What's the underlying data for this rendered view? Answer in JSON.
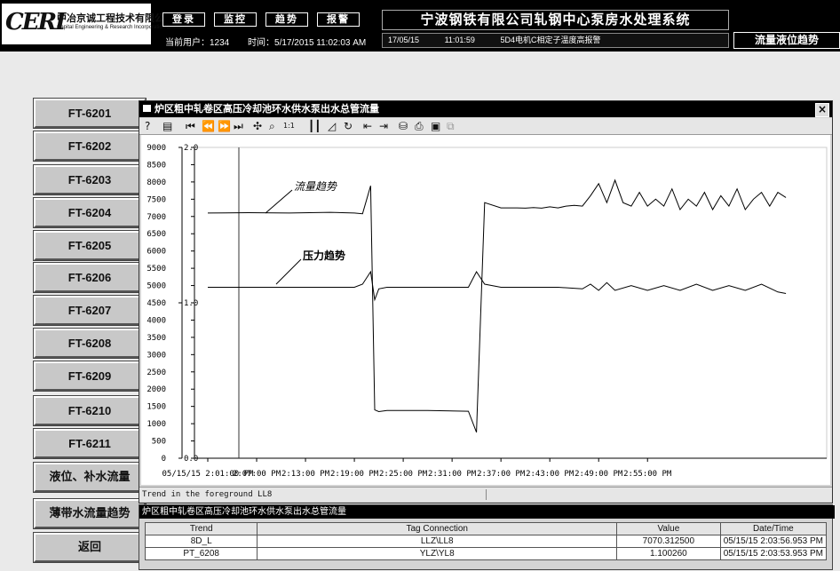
{
  "logo": {
    "mark": "CERI",
    "cn": "中冶京诚工程技术有限公司",
    "en": "Capital Engineering & Research Incorporation Limited"
  },
  "nav": [
    "登录",
    "监控",
    "趋势",
    "报警"
  ],
  "user_line": {
    "user": "当前用户：1234",
    "time": "时间：5/17/2015 11:02:03 AM"
  },
  "system_title": "宁波钢铁有限公司轧钢中心泵房水处理系统",
  "alarm": {
    "date": "17/05/15",
    "time": "11:01:59",
    "text": "5D4电机C相定子温度高报警"
  },
  "trend_title": "流量液位趋势",
  "sidebar": [
    "FT-6201",
    "FT-6202",
    "FT-6203",
    "FT-6204",
    "FT-6205",
    "FT-6206",
    "FT-6207",
    "FT-6208",
    "FT-6209",
    "FT-6210",
    "FT-6211",
    "液位、补水流量",
    "薄带水流量趋势",
    "返回"
  ],
  "window": {
    "title": "炉区粗中轧卷区高压冷却池环水供水泵出水总管流量",
    "close": "×",
    "toolbar_icons": [
      "help-icon",
      "legend-icon",
      "first-icon",
      "prev-icon",
      "next-icon",
      "last-icon",
      "cursor-icon",
      "zoom-icon",
      "original-size-icon",
      "bar-icon",
      "line-icon",
      "refresh-icon",
      "start-icon",
      "end-icon",
      "save-icon",
      "print-icon",
      "export-icon",
      "copy-icon"
    ],
    "status": "Trend in the foreground LL8"
  },
  "chart_data": {
    "type": "line",
    "y_left": {
      "ticks": [
        0,
        500,
        1000,
        1500,
        2000,
        2500,
        3000,
        3500,
        4000,
        4500,
        5000,
        5500,
        6000,
        6500,
        7000,
        7500,
        8000,
        8500,
        9000
      ],
      "range": [
        0,
        9000
      ]
    },
    "y_right": {
      "ticks": [
        "0.0",
        "1.0",
        "2.0"
      ],
      "range": [
        0,
        2
      ]
    },
    "x_ticks": [
      "05/15/15  2:01:00 PM",
      "2:07:00 PM",
      "2:13:00 PM",
      "2:19:00 PM",
      "2:25:00 PM",
      "2:31:00 PM",
      "2:37:00 PM",
      "2:43:00 PM",
      "2:49:00 PM",
      "2:55:00 PM"
    ],
    "annotations": [
      "流量趋势",
      "压力趋势"
    ],
    "series": [
      {
        "name": "8D_L",
        "color": "#000000",
        "x_min": [
          0,
          5,
          10,
          15,
          18,
          19,
          20,
          20.5,
          21,
          22,
          27,
          32,
          33,
          34,
          36,
          38,
          39,
          40,
          41,
          42,
          43,
          44,
          45,
          46,
          47,
          48,
          49,
          50,
          51,
          52,
          53,
          54,
          55,
          56,
          57,
          58,
          59,
          60,
          61,
          62,
          63,
          64,
          65,
          66,
          67,
          68,
          69,
          70,
          71
        ],
        "values": [
          7100,
          7110,
          7100,
          7120,
          7100,
          7080,
          7890,
          1400,
          1350,
          1380,
          1380,
          1360,
          750,
          7400,
          7250,
          7250,
          7240,
          7260,
          7240,
          7280,
          7250,
          7300,
          7320,
          7300,
          7600,
          7950,
          7400,
          8050,
          7400,
          7300,
          7700,
          7300,
          7500,
          7300,
          7800,
          7200,
          7500,
          7300,
          7700,
          7200,
          7600,
          7300,
          7800,
          7200,
          7500,
          7700,
          7300,
          7700,
          7550
        ]
      },
      {
        "name": "PT_6208",
        "color": "#000000",
        "x_min": [
          0,
          5,
          10,
          15,
          18,
          19,
          20,
          20.5,
          21,
          22,
          27,
          32,
          33,
          34,
          36,
          38,
          40,
          43,
          46,
          47,
          48,
          49,
          50,
          52,
          54,
          56,
          58,
          60,
          62,
          64,
          66,
          68,
          70,
          71
        ],
        "values": [
          1.1,
          1.1,
          1.1,
          1.1,
          1.1,
          1.12,
          1.2,
          1.02,
          1.09,
          1.1,
          1.1,
          1.1,
          1.2,
          1.12,
          1.1,
          1.1,
          1.1,
          1.1,
          1.09,
          1.12,
          1.08,
          1.13,
          1.08,
          1.11,
          1.08,
          1.11,
          1.08,
          1.12,
          1.08,
          1.11,
          1.08,
          1.12,
          1.07,
          1.06
        ]
      }
    ]
  },
  "tag_panel": {
    "title": "炉区粗中轧卷区高压冷却池环水供水泵出水总管流量",
    "columns": [
      "Trend",
      "Tag Connection",
      "Value",
      "Date/Time"
    ],
    "rows": [
      [
        "8D_L",
        "LLZ\\LL8",
        "7070.312500",
        "05/15/15 2:03:56.953 PM"
      ],
      [
        "PT_6208",
        "YLZ\\YL8",
        "1.100260",
        "05/15/15 2:03:53.953 PM"
      ]
    ]
  }
}
